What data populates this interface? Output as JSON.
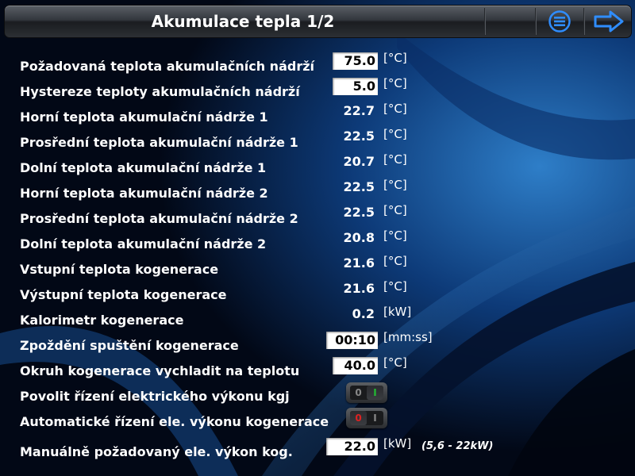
{
  "header": {
    "title": "Akumulace tepla 1/2",
    "menu_icon": "hamburger-circle-icon",
    "next_icon": "arrow-right-icon",
    "accent_color": "#2f8dff"
  },
  "rows": [
    {
      "label": "Požadovaná teplota akumulačních nádrží",
      "value": "75.0",
      "unit": "[°C]",
      "editable": true
    },
    {
      "label": "Hystereze teploty akumulačních nádrží",
      "value": "5.0",
      "unit": "[°C]",
      "editable": true
    },
    {
      "label": "Horní teplota akumulační nádrže 1",
      "value": "22.7",
      "unit": "[°C]",
      "editable": false
    },
    {
      "label": "Prosřední teplota akumulační nádrže 1",
      "value": "22.5",
      "unit": "[°C]",
      "editable": false
    },
    {
      "label": "Dolní teplota akumulační nádrže 1",
      "value": "20.7",
      "unit": "[°C]",
      "editable": false
    },
    {
      "label": "Horní teplota akumulační nádrže 2",
      "value": "22.5",
      "unit": "[°C]",
      "editable": false
    },
    {
      "label": "Prosřední teplota akumulační nádrže 2",
      "value": "22.5",
      "unit": "[°C]",
      "editable": false
    },
    {
      "label": "Dolní teplota akumulační nádrže 2",
      "value": "20.8",
      "unit": "[°C]",
      "editable": false
    },
    {
      "label": "Vstupní teplota kogenerace",
      "value": "21.6",
      "unit": "[°C]",
      "editable": false
    },
    {
      "label": "Výstupní teplota kogenerace",
      "value": "21.6",
      "unit": "[°C]",
      "editable": false
    },
    {
      "label": "Kalorimetr kogenerace",
      "value": "0.2",
      "unit": "[kW]",
      "editable": false
    },
    {
      "label": "Zpoždění spuštění kogenerace",
      "value": "00:10",
      "unit": "[mm:ss]",
      "editable": true
    },
    {
      "label": "Okruh kogenerace vychladit na teplotu",
      "value": "40.0",
      "unit": "[°C]",
      "editable": true
    }
  ],
  "toggles": [
    {
      "label": "Povolit řízení elektrického výkonu kgj",
      "off_text": "0",
      "on_text": "I",
      "state": "on",
      "on_color": "#22bb33",
      "off_color": "#888888"
    },
    {
      "label": "Automatické řízení ele. výkonu kogenerace",
      "off_text": "0",
      "on_text": "I",
      "state": "off",
      "on_color": "#888888",
      "off_color": "#dd2222"
    }
  ],
  "manual": {
    "label": "Manuálně požadovaný ele. výkon kog.",
    "value": "22.0",
    "unit": "[kW]",
    "note": "(5,6 - 22kW)"
  }
}
